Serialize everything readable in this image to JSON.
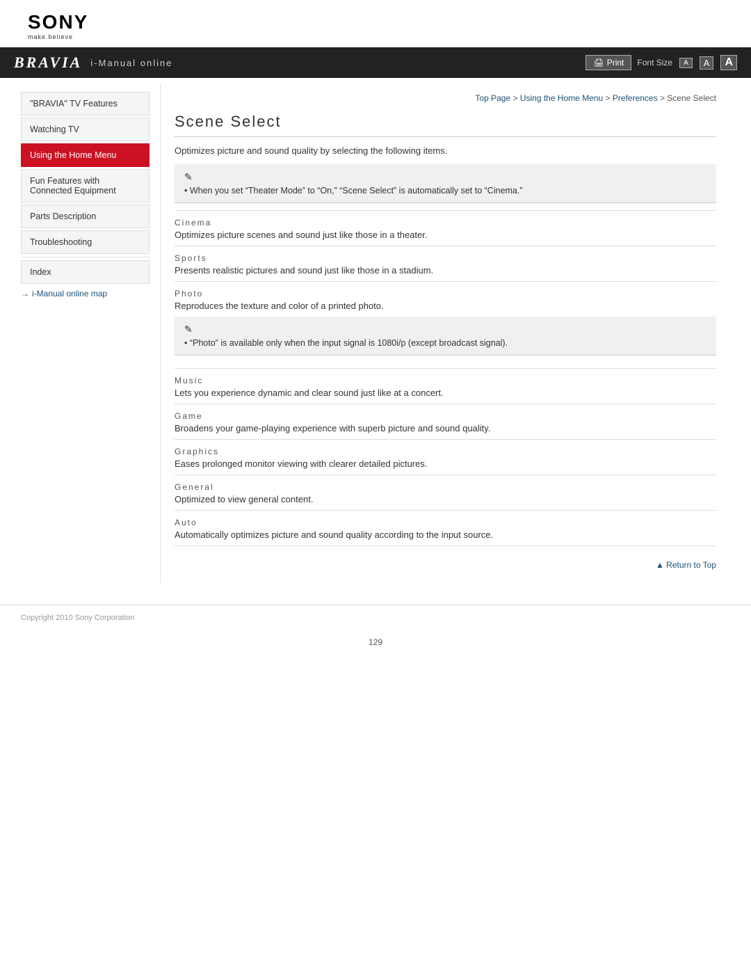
{
  "logo": {
    "brand": "SONY",
    "tagline": "make.believe"
  },
  "navbar": {
    "bravia": "BRAVIA",
    "title": "i-Manual online",
    "print_label": "Print",
    "font_size_label": "Font Size",
    "font_small": "A",
    "font_medium": "A",
    "font_large": "A"
  },
  "breadcrumb": {
    "top_page": "Top Page",
    "sep1": " > ",
    "home_menu": "Using the Home Menu",
    "sep2": " > ",
    "preferences": "Preferences",
    "sep3": " > ",
    "current": "Scene Select"
  },
  "sidebar": {
    "items": [
      {
        "label": "\"BRAVIA\" TV Features",
        "active": false
      },
      {
        "label": "Watching TV",
        "active": false
      },
      {
        "label": "Using the Home Menu",
        "active": true
      },
      {
        "label": "Fun Features with Connected Equipment",
        "active": false
      },
      {
        "label": "Parts Description",
        "active": false
      },
      {
        "label": "Troubleshooting",
        "active": false
      }
    ],
    "index_label": "Index",
    "map_link": "i-Manual online map"
  },
  "content": {
    "page_title": "Scene Select",
    "description": "Optimizes picture and sound quality by selecting the following items.",
    "note1": {
      "text": "When you set “Theater Mode” to “On,” “Scene Select” is automatically set to “Cinema.”"
    },
    "scenes": [
      {
        "label": "Cinema",
        "desc": "Optimizes picture scenes and sound just like those in a theater."
      },
      {
        "label": "Sports",
        "desc": "Presents realistic pictures and sound just like those in a stadium."
      },
      {
        "label": "Photo",
        "desc": "Reproduces the texture and color of a printed photo.",
        "has_note": true,
        "note_text": "“Photo” is available only when the input signal is 1080i/p (except broadcast signal)."
      },
      {
        "label": "Music",
        "desc": "Lets you experience dynamic and clear sound just like at a concert."
      },
      {
        "label": "Game",
        "desc": "Broadens your game-playing experience with superb picture and sound quality."
      },
      {
        "label": "Graphics",
        "desc": "Eases prolonged monitor viewing with clearer detailed pictures."
      },
      {
        "label": "General",
        "desc": "Optimized to view general content."
      },
      {
        "label": "Auto",
        "desc": "Automatically optimizes picture and sound quality according to the input source."
      }
    ],
    "return_top": "Return to Top"
  },
  "footer": {
    "copyright": "Copyright 2010 Sony Corporation"
  },
  "page_number": "129"
}
